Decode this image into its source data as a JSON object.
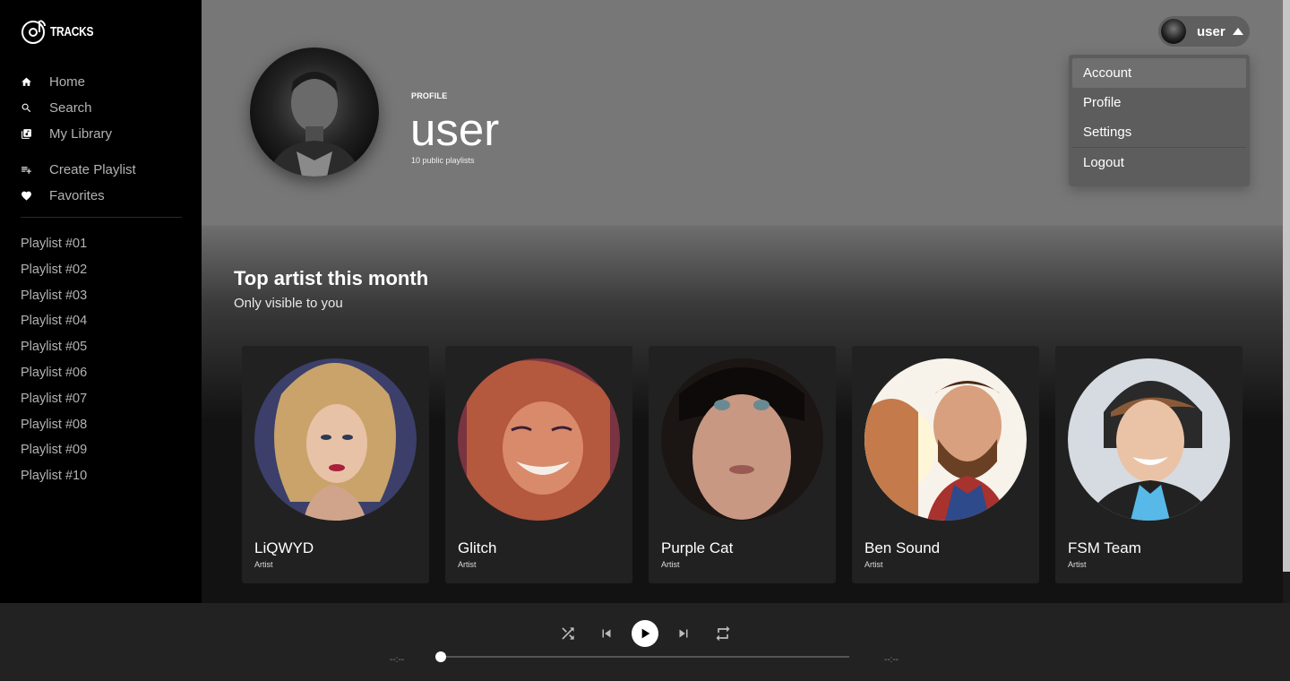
{
  "app": {
    "logo_text": "TRACKS"
  },
  "sidebar": {
    "nav": [
      {
        "label": "Home",
        "icon": "home-icon"
      },
      {
        "label": "Search",
        "icon": "search-icon"
      },
      {
        "label": "My Library",
        "icon": "library-icon"
      }
    ],
    "actions": [
      {
        "label": "Create Playlist",
        "icon": "playlist-add-icon"
      },
      {
        "label": "Favorites",
        "icon": "heart-icon"
      }
    ],
    "playlists": [
      "Playlist #01",
      "Playlist #02",
      "Playlist #03",
      "Playlist #04",
      "Playlist #05",
      "Playlist #06",
      "Playlist #07",
      "Playlist #08",
      "Playlist #09",
      "Playlist #10"
    ]
  },
  "profile": {
    "label": "PROFILE",
    "name": "user",
    "subtitle": "10 public playlists"
  },
  "user_menu": {
    "username": "user",
    "items": [
      "Account",
      "Profile",
      "Settings",
      "Logout"
    ],
    "active": "Account"
  },
  "section": {
    "title": "Top artist this month",
    "subtitle": "Only visible to you"
  },
  "artists": [
    {
      "name": "LiQWYD",
      "type": "Artist"
    },
    {
      "name": "Glitch",
      "type": "Artist"
    },
    {
      "name": "Purple Cat",
      "type": "Artist"
    },
    {
      "name": "Ben Sound",
      "type": "Artist"
    },
    {
      "name": "FSM Team",
      "type": "Artist"
    }
  ],
  "player": {
    "elapsed": "--:--",
    "duration": "--:--",
    "progress": 0
  },
  "colors": {
    "sidebar_bg": "#000000",
    "header_bg": "#777777",
    "card_bg": "#212121",
    "player_bg": "#222222"
  }
}
